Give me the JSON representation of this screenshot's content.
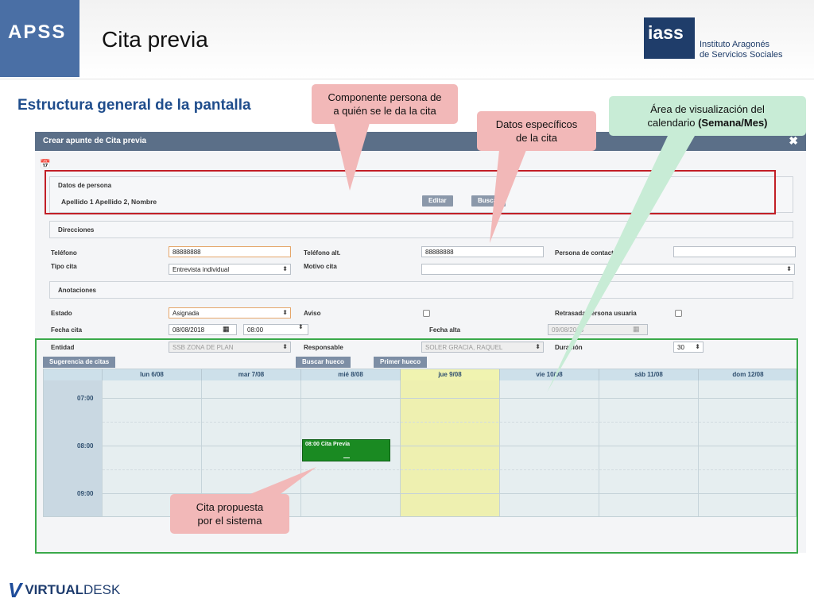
{
  "header": {
    "badge": "APSS",
    "title": "Cita previa",
    "logo_mark": "iass",
    "logo_line1": "Instituto Aragonés",
    "logo_line2": "de Servicios Sociales"
  },
  "section_heading": "Estructura general de la pantalla",
  "callouts": {
    "persona_line1": "Componente persona de",
    "persona_line2": "a quién se le da la cita",
    "datos_line1": "Datos específicos",
    "datos_line2": "de la cita",
    "area_line1": "Área de visualización del",
    "area_line2_prefix": "calendario ",
    "area_line2_bold": "(Semana/Mes)",
    "propuesta_line1": "Cita propuesta",
    "propuesta_line2": "por el sistema"
  },
  "app": {
    "title": "Crear apunte de Cita previa",
    "close_icon": "close-icon",
    "persona_panel": {
      "title": "Datos de persona",
      "name": "Apellido 1 Apellido 2, Nombre",
      "edit_label": "Editar",
      "search_label": "Buscar"
    },
    "direcciones_title": "Direcciones",
    "telefono_label": "Teléfono",
    "telefono_value": "88888888",
    "telefono_alt_label": "Teléfono alt.",
    "telefono_alt_value": "88888888",
    "persona_contacto_label": "Persona de contacto",
    "persona_contacto_value": "",
    "tipo_cita_label": "Tipo cita",
    "tipo_cita_value": "Entrevista individual",
    "motivo_cita_label": "Motivo cita",
    "motivo_cita_value": "",
    "anotaciones_title": "Anotaciones",
    "estado_label": "Estado",
    "estado_value": "Asignada",
    "aviso_label": "Aviso",
    "retrasada_label": "Retrasada persona usuaria",
    "fecha_cita_label": "Fecha cita",
    "fecha_cita_value": "08/08/2018",
    "hora_value": "08:00",
    "fecha_alta_label": "Fecha alta",
    "fecha_alta_value": "09/08/2016",
    "entidad_label": "Entidad",
    "entidad_value": "SSB ZONA DE PLAN",
    "responsable_label": "Responsable",
    "responsable_value": "SOLER GRACIA, RAQUEL",
    "duracion_label": "Duración",
    "duracion_value": "30"
  },
  "calendar": {
    "tabs": [
      "Sugerencia de citas",
      "Buscar hueco",
      "Primer hueco"
    ],
    "days": [
      "lun 6/08",
      "mar 7/08",
      "mié 8/08",
      "jue 9/08",
      "vie 10/08",
      "sáb 11/08",
      "dom 12/08"
    ],
    "today_index": 3,
    "times": [
      "07:00",
      "08:00",
      "09:00"
    ],
    "appointment": {
      "label": "08:00 Cita Previa",
      "day_index": 2
    }
  },
  "footer": {
    "logo_mark": "V",
    "logo_bold": "VIRTUAL",
    "logo_light": "DESK"
  },
  "colors": {
    "brand_blue": "#4a6fa5",
    "heading_blue": "#1f4d8c",
    "callout_red": "#f2b8b8",
    "callout_green": "#c8ecd6",
    "box_red": "#c21f27",
    "box_green": "#3aa94a",
    "appointment_green": "#1a8a22",
    "today_yellow": "#eef0b0"
  }
}
